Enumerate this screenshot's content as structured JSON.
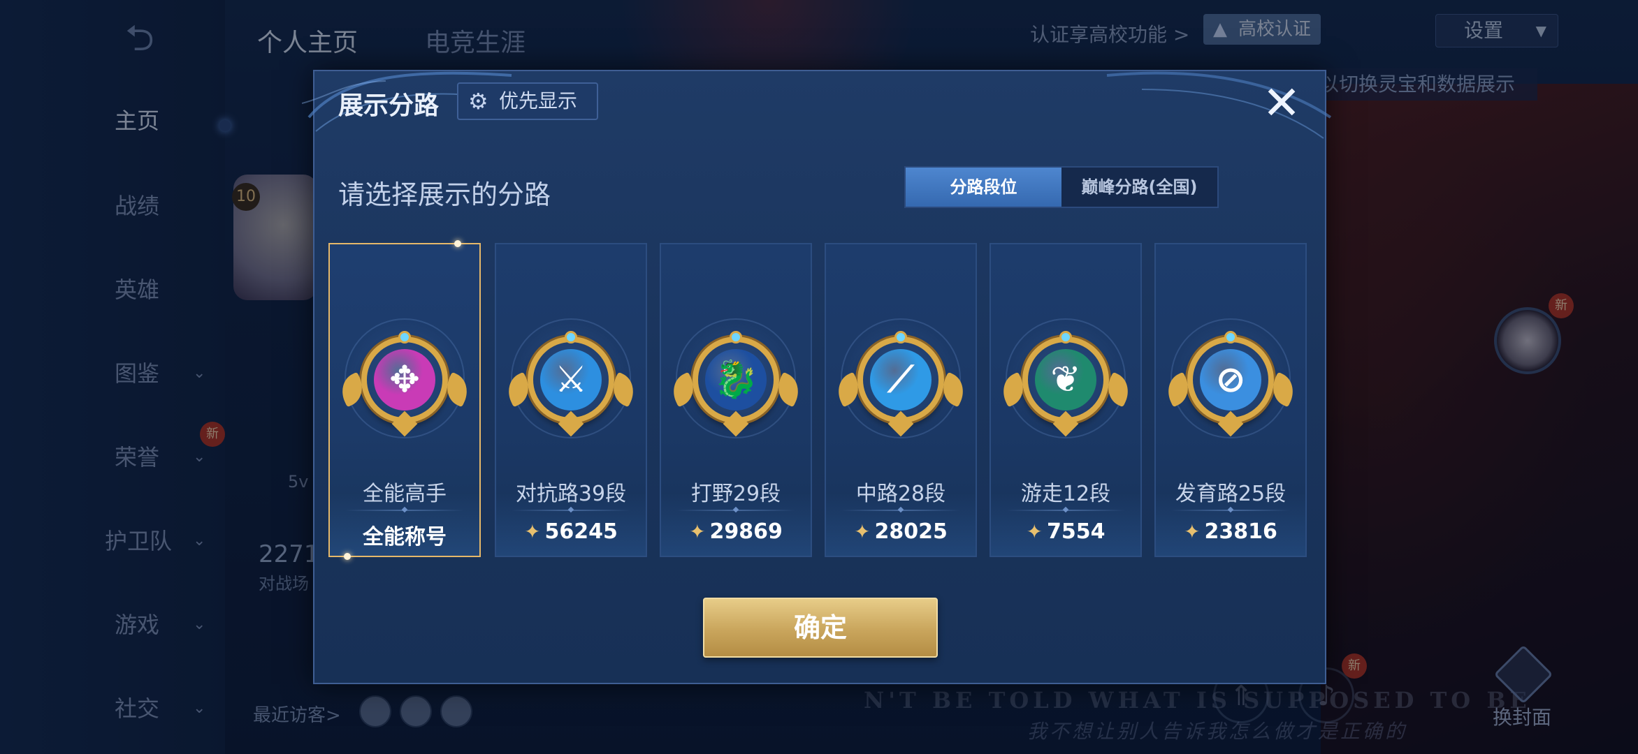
{
  "sidebar": {
    "back_icon": "back-arrow-icon",
    "items": [
      {
        "label": "主页",
        "active": true,
        "has_chevron": false
      },
      {
        "label": "战绩",
        "active": false,
        "has_chevron": false
      },
      {
        "label": "英雄",
        "active": false,
        "has_chevron": false
      },
      {
        "label": "图鉴",
        "active": false,
        "has_chevron": true
      },
      {
        "label": "荣誉",
        "active": false,
        "has_chevron": true,
        "badge": "新"
      },
      {
        "label": "护卫队",
        "active": false,
        "has_chevron": true
      },
      {
        "label": "游戏",
        "active": false,
        "has_chevron": true
      },
      {
        "label": "社交",
        "active": false,
        "has_chevron": true
      }
    ]
  },
  "header": {
    "tabs": [
      "个人主页",
      "电竞生涯"
    ],
    "cert_text": "认证享高校功能 >",
    "school_button": "高校认证",
    "settings": "设置",
    "switch_hint": "以切换灵宝和数据展示"
  },
  "background": {
    "level": "10",
    "mode_text": "5v",
    "count": "2271",
    "count_label": "对战场",
    "visitors_label": "最近访客>",
    "slogan_en": "N'T BE TOLD WHAT IS SUPPOSED TO BE",
    "slogan_cn": "我不想让别人告诉我怎么做才是正确的",
    "cover_button": "换封面",
    "new_badge": "新"
  },
  "modal": {
    "title": "展示分路",
    "priority_button": "优先显示",
    "close_icon": "close-icon",
    "subtitle": "请选择展示的分路",
    "segment": {
      "options": [
        "分路段位",
        "巅峰分路(全国)"
      ],
      "selected_index": 0
    },
    "cards": [
      {
        "name": "全能高手",
        "value": "全能称号",
        "show_points_icon": false,
        "selected": true,
        "color": "#c93bb6",
        "glyph": "✥",
        "icon": "all-round-emblem-icon"
      },
      {
        "name": "对抗路39段",
        "value": "56245",
        "show_points_icon": true,
        "selected": false,
        "color": "#2d8fe0",
        "glyph": "⚔",
        "icon": "clash-lane-emblem-icon"
      },
      {
        "name": "打野29段",
        "value": "29869",
        "show_points_icon": true,
        "selected": false,
        "color": "#1d4fa0",
        "glyph": "🐉",
        "icon": "jungle-emblem-icon"
      },
      {
        "name": "中路28段",
        "value": "28025",
        "show_points_icon": true,
        "selected": false,
        "color": "#2f9ae6",
        "glyph": "⟋",
        "icon": "mid-lane-emblem-icon"
      },
      {
        "name": "游走12段",
        "value": "7554",
        "show_points_icon": true,
        "selected": false,
        "color": "#1f8a6e",
        "glyph": "❦",
        "icon": "roam-emblem-icon"
      },
      {
        "name": "发育路25段",
        "value": "23816",
        "show_points_icon": true,
        "selected": false,
        "color": "#3b8fe0",
        "glyph": "⊘",
        "icon": "farm-lane-emblem-icon"
      }
    ],
    "confirm_button": "确定"
  },
  "colors": {
    "modal_bg": "#1f3b66",
    "accent_blue": "#4e86cf",
    "gold": "#d9a947",
    "confirm_gold": "#c9a55c"
  }
}
